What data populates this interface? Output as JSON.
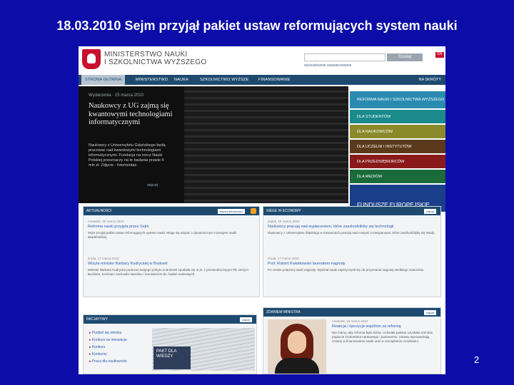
{
  "slide": {
    "title": "18.03.2010 Sejm przyjął pakiet ustaw reformujących system nauki",
    "page_number": "2"
  },
  "site": {
    "logo_line1": "MINISTERSTWO NAUKI",
    "logo_line2": "I SZKOLNICTWA WYŻSZEGO",
    "search_button": "Szukaj",
    "advanced_search": "wyszukiwanie zaawansowane",
    "lang": "EN",
    "nav": [
      {
        "label": "STRONA GŁÓWNA"
      },
      {
        "label": "MINISTERSTWO"
      },
      {
        "label": "NAUKA"
      },
      {
        "label": "SZKOLNICTWO WYŻSZE"
      },
      {
        "label": "FINANSOWANIE"
      }
    ],
    "nav_right": "NA SKRÓTY",
    "hero": {
      "date": "Wydarzenia · 15 marca 2010",
      "title": "Naukowcy z UG zajmą się kwantowymi technologiami informatycznymi",
      "desc": "Naukowcy z Uniwersytetu Gdańskiego będą pracować nad kwantowymi technologiami informatycznymi. Fundacja na rzecz Nauki Polskiej przeznaczy na te badania prawie 4 mln zł. Zdjęcie - fotomontaż.",
      "more": "więcej"
    },
    "right_menu": [
      {
        "label": "REFORMA NAUKI I SZKOLNICTWA WYŻSZEGO",
        "color": "#2a8bb0"
      },
      {
        "label": "DLA STUDENTÓW",
        "color": "#1a8a8a"
      },
      {
        "label": "DLA NAUKOWCÓW",
        "color": "#8a8a2a"
      },
      {
        "label": "DLA UCZELNI I INSTYTUTÓW",
        "color": "#5a3a1a"
      },
      {
        "label": "DLA PRZEDSIĘBIORCÓW",
        "color": "#8a1a1a"
      },
      {
        "label": "DLA MEDIÓW",
        "color": "#1a6a3a"
      },
      {
        "label": "FUNDUSZE EUROPEJSKIE",
        "color": "#1a3f8a"
      }
    ],
    "aktualnosci": {
      "header": "AKTUALNOŚCI",
      "link": "więcej aktualności",
      "items": [
        {
          "date": "czwartek, 18 marca 2010",
          "title": "Reforma nauki przyjęta przez Sejm",
          "body": "Sejm przyjął pakiet ustaw reformujących system nauki. Mogę się wiązać z dynamicznym rozwojem nauki akademickiej."
        },
        {
          "date": "środa, 17 marca 2010",
          "title": "Wizyta minister Barbary Kudryckiej w Brukseli",
          "body": "Minister Barbara Kudrycka podczas swojego pobytu w Brukseli spotkała się m.in. z przewodniczącym PE Jerzym Buzkiem, komisarz Androulla Vassiliou i komisarzem ds. badań naukowych."
        }
      ]
    },
    "sience": {
      "header": "SIEGE W ECONOMY",
      "link": "więcej",
      "items": [
        {
          "date": "piątek, 19 marca 2010",
          "title": "Naukowcy pracują nad wypłaceniem, które zaszkodziłoby się technologii",
          "body": "Naukowcy z Uniwersytetu Śląskiego w Katowicach pracują nad nowymi rozwiązaniami, które zaszkodziłyby się Wody."
        },
        {
          "date": "środa, 17 marca 2010",
          "title": "Prof. Robert Kwiatkowski laureatem nagrody",
          "body": "Po czasie potężnej nauki nagrody. Wydział nauki zaprzyczynił się do przyznania nagrody wielkiego znaczenia."
        }
      ]
    },
    "inicjatywy": {
      "header": "INICJATYWY",
      "link": "więcej",
      "items": [
        "Podziel się wiedzą",
        "Konkurs na innowacje",
        "Konkurs",
        "Konkursy",
        "Praca dla naukowców"
      ],
      "pakt_label": "PAKT DLA WIEDZY"
    },
    "zdaniem": {
      "header": "ZDANIEM MINISTRA",
      "link": "więcej",
      "date": "czwartek, 18 marca 2010",
      "title": "Reakcja i opozycja wspólnie za reformą",
      "body": "Nie mamy, aby reforma była dobra. Uchwała pakietu uzyskała szerokie poparcie środowiska naukowego i parlamentu. Ustawy wprowadzają zmiany w finansowaniu nauki oraz w zarządzaniu uczelniami."
    }
  }
}
